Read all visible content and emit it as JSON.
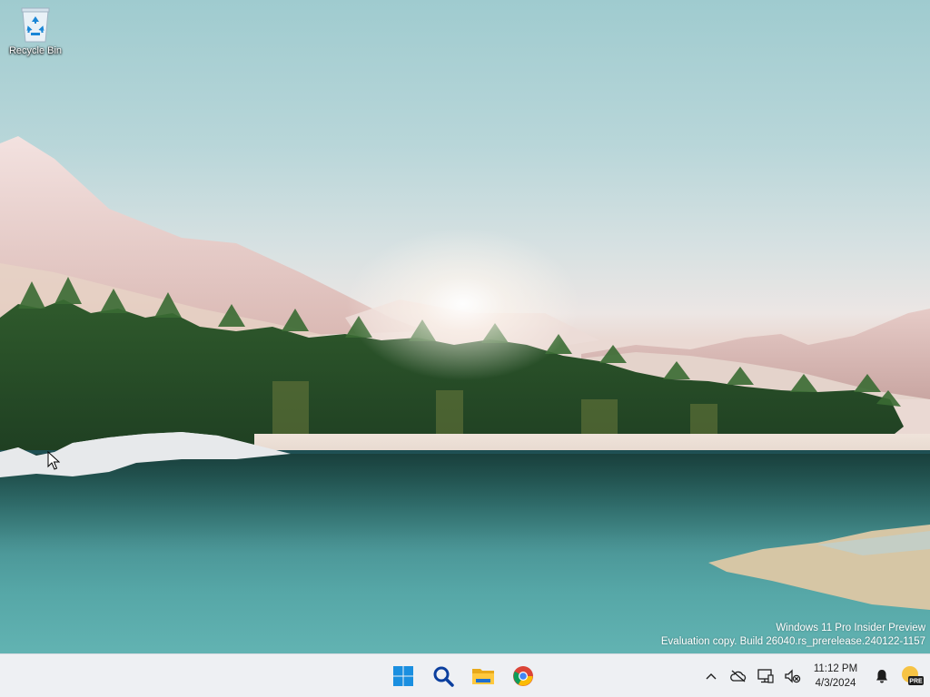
{
  "desktop": {
    "icons": [
      {
        "label": "Recycle Bin",
        "icon": "recycle-bin-icon"
      }
    ],
    "watermark": {
      "line1": "Windows 11 Pro Insider Preview",
      "line2": "Evaluation copy. Build 26040.rs_prerelease.240122-1157"
    }
  },
  "taskbar": {
    "apps": [
      {
        "name": "start",
        "icon": "windows-logo-icon"
      },
      {
        "name": "search",
        "icon": "search-icon"
      },
      {
        "name": "file-explorer",
        "icon": "folder-icon"
      },
      {
        "name": "chrome",
        "icon": "chrome-icon"
      }
    ],
    "tray": {
      "icons": [
        "chevron-up-icon",
        "cloud-offline-icon",
        "network-icon",
        "speaker-muted-icon"
      ],
      "time": "11:12 PM",
      "date": "4/3/2024",
      "notification_icon": "bell-icon",
      "insider_badge": "PRE"
    }
  },
  "colors": {
    "taskbar_bg": "#eef0f3",
    "accent_blue": "#0f6cbd",
    "start_blue": "#1a8fe0"
  }
}
